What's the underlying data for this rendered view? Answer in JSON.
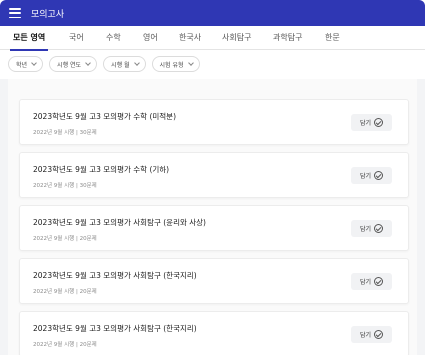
{
  "appbar": {
    "title": "모의고사"
  },
  "tabs": [
    {
      "label": "모든 영역"
    },
    {
      "label": "국어"
    },
    {
      "label": "수학"
    },
    {
      "label": "영어"
    },
    {
      "label": "한국사"
    },
    {
      "label": "사회탐구"
    },
    {
      "label": "과학탐구"
    },
    {
      "label": "한문"
    }
  ],
  "filters": [
    {
      "label": "학년"
    },
    {
      "label": "시행 연도"
    },
    {
      "label": "시행 월"
    },
    {
      "label": "시험 유형"
    }
  ],
  "cards": [
    {
      "title": "2023학년도 9월 고3 모의평가 수학 (미적분)",
      "meta": "2022년 9월 시행 | 30문제",
      "save_label": "담기"
    },
    {
      "title": "2023학년도 9월 고3 모의평가 수학 (기하)",
      "meta": "2022년 9월 시행 | 30문제",
      "save_label": "담기"
    },
    {
      "title": "2023학년도 9월 고3 모의평가 사회탐구 (윤리와 사상)",
      "meta": "2022년 9월 시행 | 20문제",
      "save_label": "담기"
    },
    {
      "title": "2023학년도 9월 고3 모의평가 사회탐구 (한국지리)",
      "meta": "2022년 9월 시행 | 20문제",
      "save_label": "담기"
    },
    {
      "title": "2023학년도 9월 고3 모의평가 사회탐구 (한국지리)",
      "meta": "2022년 9월 시행 | 20문제",
      "save_label": "담기"
    }
  ],
  "colors": {
    "accent": "#2f37b4",
    "background": "#f3f4f6"
  }
}
